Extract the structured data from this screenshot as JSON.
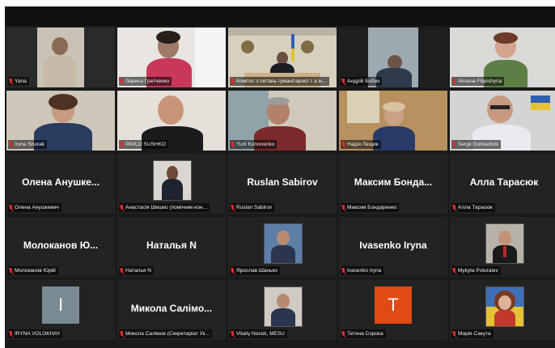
{
  "colors": {
    "active_border": "#c8e632",
    "muted_mic": "#e02b2b",
    "tile_bg": "#232323"
  },
  "participants": [
    {
      "label": "Yana",
      "big_name": "",
      "kind": "video"
    },
    {
      "label": "Лариса Гретченко",
      "big_name": "",
      "kind": "video"
    },
    {
      "label": "Комітет з питань гуманітарної т а ін...",
      "big_name": "",
      "kind": "video",
      "active": true
    },
    {
      "label": "Андрій Бобик",
      "big_name": "",
      "kind": "video"
    },
    {
      "label": "Aksana Filipishyna",
      "big_name": "",
      "kind": "video"
    },
    {
      "label": "Iryna Shurak",
      "big_name": "",
      "kind": "video"
    },
    {
      "label": "PAVLO SUSHKO",
      "big_name": "",
      "kind": "video"
    },
    {
      "label": "Yurii Kononenko",
      "big_name": "",
      "kind": "video"
    },
    {
      "label": "Надія Лещик",
      "big_name": "",
      "kind": "video"
    },
    {
      "label": "Sergii Gorbachov",
      "big_name": "",
      "kind": "video"
    },
    {
      "label": "Олена Анушкевич",
      "big_name": "Олена Анушке...",
      "kind": "name"
    },
    {
      "label": "Анастасія Шишко (помічник-кон...",
      "big_name": "",
      "kind": "photo"
    },
    {
      "label": "Ruslan Sabirov",
      "big_name": "Ruslan Sabirov",
      "kind": "name"
    },
    {
      "label": "Максим Бондаренко",
      "big_name": "Максим Бонда...",
      "kind": "name"
    },
    {
      "label": "Алла Тарасюк",
      "big_name": "Алла Тарасюк",
      "kind": "name"
    },
    {
      "label": "Молоканов Юрій",
      "big_name": "Молоканов Ю...",
      "kind": "name"
    },
    {
      "label": "Наталья N",
      "big_name": "Наталья N",
      "kind": "name"
    },
    {
      "label": "Ярослав Шанько",
      "big_name": "",
      "kind": "photo"
    },
    {
      "label": "Ivasenko Iryna",
      "big_name": "Ivasenko Iryna",
      "kind": "name"
    },
    {
      "label": "Mykyta Poturaiev",
      "big_name": "",
      "kind": "photo"
    },
    {
      "label": "IRYNA VOLOKHAY",
      "big_name": "",
      "kind": "avatar",
      "initial": "I",
      "avatar_color": "#7a8a93"
    },
    {
      "label": "Микола Салімов (Секретаріат Ук...",
      "big_name": "Микола Салімо...",
      "kind": "name"
    },
    {
      "label": "Vitaliy Nosok, MESU",
      "big_name": "",
      "kind": "photo"
    },
    {
      "label": "Тетяна Сорока",
      "big_name": "",
      "kind": "avatar",
      "initial": "T",
      "avatar_color": "#e04a14"
    },
    {
      "label": "Марія Сакута",
      "big_name": "",
      "kind": "photo"
    }
  ]
}
